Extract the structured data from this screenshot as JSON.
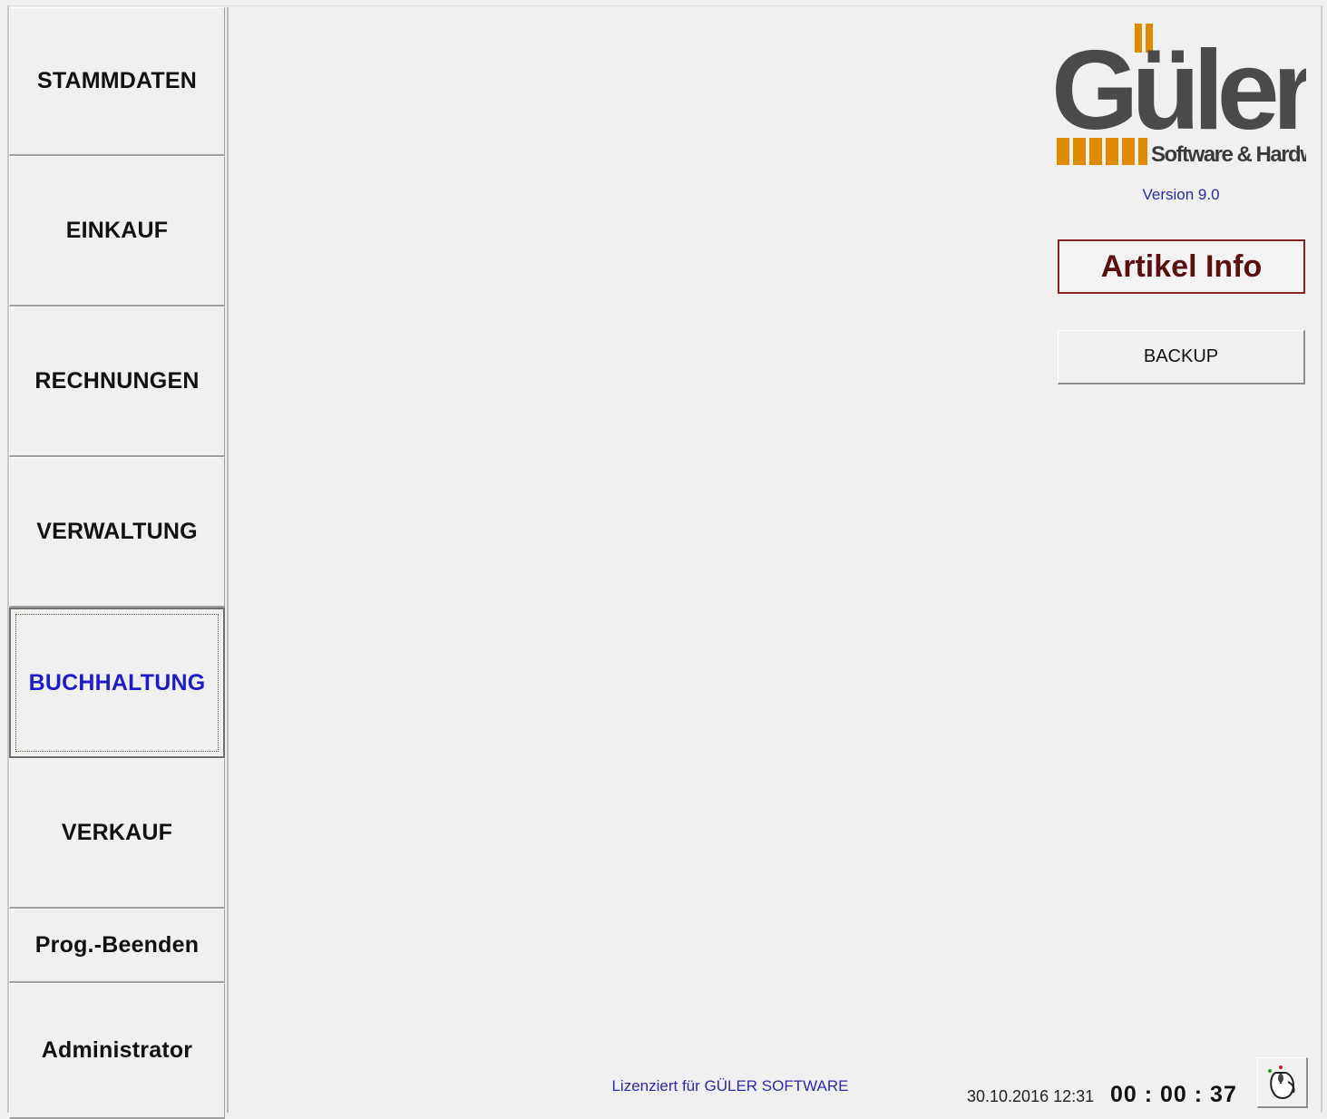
{
  "nav": {
    "items": [
      {
        "label": "STAMMDATEN"
      },
      {
        "label": "EINKAUF"
      },
      {
        "label": "RECHNUNGEN"
      },
      {
        "label": "VERWALTUNG"
      },
      {
        "label": "BUCHHALTUNG",
        "active": true
      },
      {
        "label": "VERKAUF"
      },
      {
        "label": "Prog.-Beenden"
      },
      {
        "label": "Administrator"
      }
    ]
  },
  "logo": {
    "brand": "Güler",
    "tagline": "Software & Hardware",
    "colors": {
      "text": "#4a4a4a",
      "accent": "#e08a00"
    }
  },
  "version": "Version 9.0",
  "buttons": {
    "artikel_info": "Artikel Info",
    "backup": "BACKUP",
    "mouse_icon": "mouse-icon"
  },
  "footer": {
    "license": "Lizenziert für GÜLER SOFTWARE",
    "datetime": "30.10.2016 12:31",
    "timer": "00 : 00 : 37"
  },
  "colors": {
    "active_nav_text": "#1c1cc9",
    "artikel_border": "#8a2424",
    "link_blue": "#2b2bb0"
  }
}
